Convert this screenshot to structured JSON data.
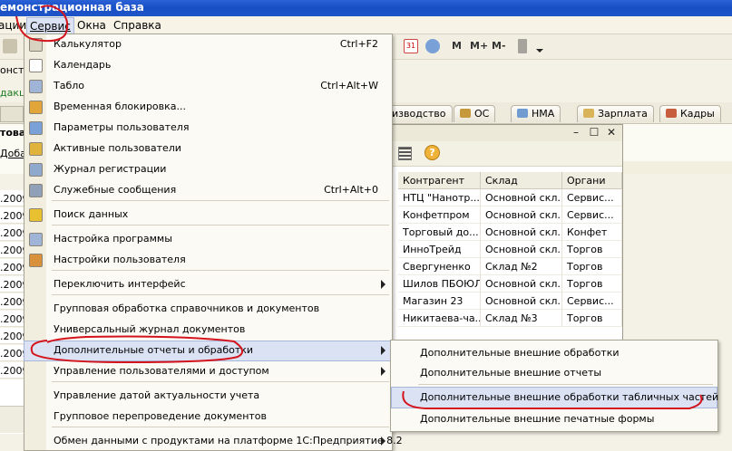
{
  "window": {
    "title": "емонстрационная база"
  },
  "menubar": {
    "items": [
      "ации",
      "Сервис",
      "Окна",
      "Справка"
    ]
  },
  "toolbar": {
    "buttons": [
      "M",
      "M+",
      "M-"
    ]
  },
  "background": {
    "texts": [
      "онстр",
      "дакц",
      "това",
      "Доба"
    ],
    "tabs": [
      "изводство",
      "ОС",
      "НМА",
      "Зарплата",
      "Кадры"
    ],
    "left_col": [
      ".2009",
      ".2009",
      ".2009",
      ".2009",
      ".2009",
      ".2009",
      ".2009",
      ".2009",
      ".2009",
      ".2009",
      ".2009"
    ]
  },
  "journal": {
    "columns": [
      "Контрагент",
      "Склад",
      "Органи"
    ],
    "rows": [
      [
        "НТЦ \"Нанотр...",
        "Основной скл...",
        "Сервис..."
      ],
      [
        "Конфетпром",
        "Основной скл...",
        "Сервис..."
      ],
      [
        "Торговый до...",
        "Основной скл...",
        "Конфет"
      ],
      [
        "ИнноТрейд",
        "Основной скл...",
        "Торгов"
      ],
      [
        "Свергуненко",
        "Склад №2",
        "Торгов"
      ],
      [
        "Шилов ПБОЮЛ",
        "Основной скл...",
        "Торгов"
      ],
      [
        "Магазин 23",
        "Основной скл...",
        "Сервис..."
      ],
      [
        "Никитаева-ча...",
        "Склад №3",
        "Торгов"
      ]
    ]
  },
  "service_menu": {
    "items": [
      {
        "label": "Калькулятор",
        "shortcut": "Ctrl+F2",
        "icon": "calculator-icon"
      },
      {
        "label": "Календарь",
        "shortcut": "",
        "icon": "calendar-icon"
      },
      {
        "label": "Табло",
        "shortcut": "Ctrl+Alt+W",
        "icon": "scoreboard-icon"
      },
      {
        "label": "Временная блокировка...",
        "shortcut": "",
        "icon": "lock-user-icon"
      },
      {
        "label": "Параметры пользователя",
        "shortcut": "",
        "icon": "user-settings-icon"
      },
      {
        "label": "Активные пользователи",
        "shortcut": "",
        "icon": "active-users-icon"
      },
      {
        "label": "Журнал регистрации",
        "shortcut": "",
        "icon": "event-log-icon"
      },
      {
        "label": "Служебные сообщения",
        "shortcut": "Ctrl+Alt+0",
        "icon": "messages-icon"
      },
      {
        "label": "Поиск данных",
        "shortcut": "",
        "icon": "search-data-icon"
      },
      {
        "label": "Настройка программы",
        "shortcut": "",
        "icon": "program-settings-icon"
      },
      {
        "label": "Настройки пользователя",
        "shortcut": "",
        "icon": "user-icon"
      },
      {
        "label": "Переключить интерфейс",
        "shortcut": "",
        "icon": ""
      },
      {
        "label": "Групповая обработка справочников и документов",
        "shortcut": "",
        "icon": ""
      },
      {
        "label": "Универсальный журнал документов",
        "shortcut": "",
        "icon": ""
      },
      {
        "label": "Дополнительные отчеты и обработки",
        "shortcut": "",
        "icon": ""
      },
      {
        "label": "Управление пользователями и доступом",
        "shortcut": "",
        "icon": ""
      },
      {
        "label": "Управление датой актуальности учета",
        "shortcut": "",
        "icon": ""
      },
      {
        "label": "Групповое перепроведение документов",
        "shortcut": "",
        "icon": ""
      },
      {
        "label": "Обмен данными с продуктами на платформе 1С:Предприятие 8.2",
        "shortcut": "",
        "icon": ""
      }
    ]
  },
  "submenu": {
    "items": [
      "Дополнительные внешние обработки",
      "Дополнительные внешние отчеты",
      "Дополнительные внешние обработки табличных частей",
      "Дополнительные внешние печатные формы"
    ]
  },
  "colors": {
    "highlight": "#dbe2f4",
    "annotation": "#d4141c",
    "titlebar": "#1f57cc"
  }
}
